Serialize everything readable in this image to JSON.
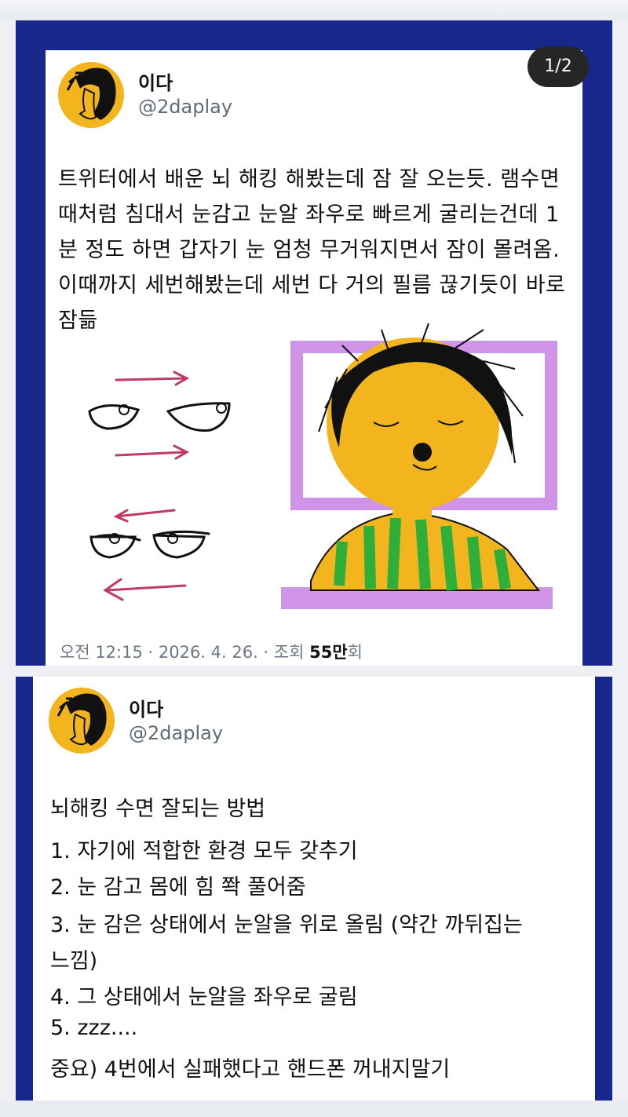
{
  "page_indicator": "1/2",
  "tweet1": {
    "name": "이다",
    "handle": "@2daplay",
    "text": "트위터에서 배운 뇌 해킹 해봤는데 잠 잘 오는듯. 램수면때처럼 침대서 눈감고 눈알 좌우로 빠르게 굴리는건데 1분 정도 하면 갑자기 눈 엄청 무거워지면서 잠이 몰려옴. 이때까지 세번해봤는데 세번 다 거의 필름 끊기듯이 바로 잠듦",
    "meta_prefix": "오전 12:15 · 2026. 4. 26. · 조회 ",
    "views": "55만",
    "views_suffix": "회"
  },
  "tweet2": {
    "name": "이다",
    "handle": "@2daplay",
    "lines": [
      "뇌해킹 수면 잘되는 방법",
      "1. 자기에 적합한 환경 모두 갖추기",
      "2. 눈 감고 몸에 힘 쫙 풀어줌",
      "3. 눈 감은 상태에서 눈알을 위로 올림 (약간 까뒤집는",
      "느낌)",
      "4. 그 상태에서 눈알을 좌우로 굴림",
      "5. zzz....",
      "중요) 4번에서 실패했다고 핸드폰 꺼내지말기"
    ]
  },
  "colors": {
    "frame": "#17288a",
    "avatar": "#f3b51d",
    "badge": "#262626",
    "arrow": "#c03a6a",
    "pillow": "#cf93e8",
    "stripe": "#2fae3a"
  }
}
